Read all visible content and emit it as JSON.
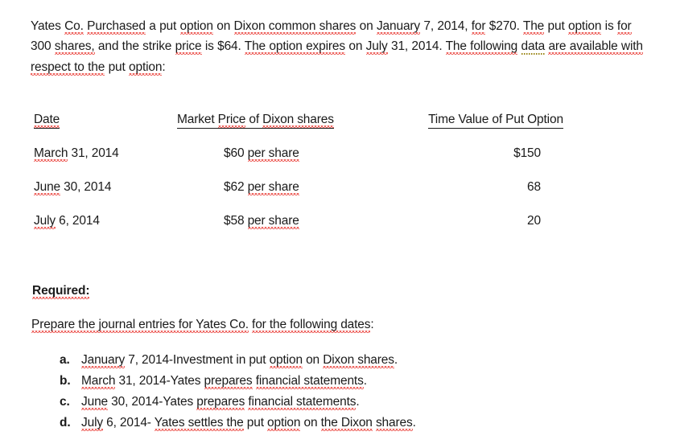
{
  "document": {
    "background_color": "#ffffff",
    "text_color": "#1a1a1a",
    "spellcheck_underline_color": "#e8302a",
    "grammar_underline_color": "#9a8414"
  },
  "intro": {
    "p1_a": "Yates ",
    "p1_co": "Co.",
    "p1_b": " ",
    "p1_purchased": "Purchased",
    "p1_c": " a put ",
    "p1_option": "option",
    "p1_d": " on ",
    "p1_dixon": "Dixon common shares",
    "p1_e": " on ",
    "p1_january": "January",
    "p1_f": " 7, 2014, ",
    "p1_for": "for",
    "p1_g": " $270. ",
    "p1_the": "The",
    "p1_h": " put ",
    "p1_option2": "option",
    "p1_i": " is ",
    "p1_for2": "for",
    "p1_j": " 300 ",
    "p1_shares": "shares,",
    "p1_k": " and the strike ",
    "p1_price": "price",
    "p1_l": " is $64. ",
    "p1_theoption": "The option expires",
    "p1_m": " on ",
    "p1_july": "July",
    "p1_n": " 31, 2014. ",
    "p1_following": "The following",
    "p1_o": " ",
    "p1_data": "data",
    "p1_p": " ",
    "p1_available": "are available with respect to the",
    "p1_q": " put ",
    "p1_option3": "option",
    "p1_r": ":"
  },
  "table": {
    "headers": {
      "date": "Date",
      "market_price": "Market Price of Dixon shares",
      "market_price_parts": {
        "a": "Market ",
        "price": "Price",
        "b": " of ",
        "dixon": "Dixon shares"
      },
      "time_value": "Time Value of Put Option"
    },
    "rows": [
      {
        "date_month": "March",
        "date_rest": " 31, 2014",
        "price_amount": "$60 ",
        "price_unit": "per share",
        "time_value": "$150"
      },
      {
        "date_month": "June",
        "date_rest": " 30, 2014",
        "price_amount": "$62 ",
        "price_unit": "per share",
        "time_value": "68"
      },
      {
        "date_month": "July",
        "date_rest": " 6, 2014",
        "price_amount": "$58 ",
        "price_unit": "per share",
        "time_value": "20"
      }
    ]
  },
  "required": {
    "heading": "Required:",
    "prepare": {
      "a": "Prepare the journal entries for Yates Co.",
      "b": " ",
      "c": "for the following dates",
      "d": ":"
    },
    "items": [
      {
        "marker": "a.",
        "p1": "January",
        "p2": " 7, 2014-Investment in put ",
        "p3": "option",
        "p4": " on ",
        "p5": "Dixon shares",
        "p6": "."
      },
      {
        "marker": "b.",
        "p1": "March",
        "p2": " 31, 2014-Yates ",
        "p3": "prepares",
        "p4": " ",
        "p5": "financial statements",
        "p6": "."
      },
      {
        "marker": "c.",
        "p1": "June",
        "p2": " 30, 2014-Yates ",
        "p3": "prepares",
        "p4": " ",
        "p5": "financial statements",
        "p6": "."
      },
      {
        "marker": "d.",
        "p1": "July",
        "p2": " 6, 2014- ",
        "p3": "Yates settles the",
        "p4": " put ",
        "p5": "option",
        "p6": " on ",
        "p7": "the Dixon",
        "p8": " ",
        "p9": "shares",
        "p10": "."
      }
    ]
  }
}
